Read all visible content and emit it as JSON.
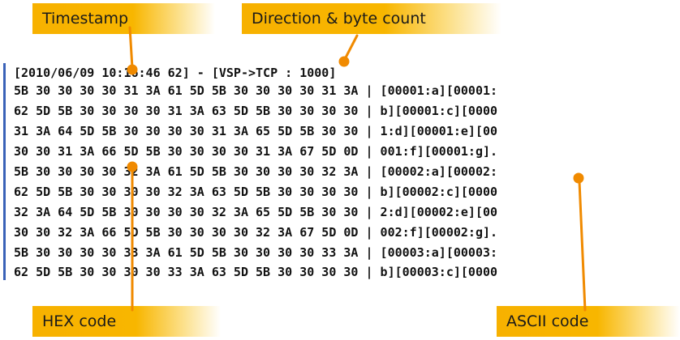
{
  "callouts": {
    "timestamp": "Timestamp",
    "direction": "Direction & byte count",
    "hex": "HEX code",
    "ascii": "ASCII code"
  },
  "log": {
    "header": "[2010/06/09 10:16:46 62] - [VSP->TCP : 1000]",
    "rows": [
      {
        "hex": "5B 30 30 30 30 31 3A 61 5D 5B 30 30 30 30 31 3A",
        "ascii": "[00001:a][00001:"
      },
      {
        "hex": "62 5D 5B 30 30 30 30 31 3A 63 5D 5B 30 30 30 30",
        "ascii": "b][00001:c][0000"
      },
      {
        "hex": "31 3A 64 5D 5B 30 30 30 30 31 3A 65 5D 5B 30 30",
        "ascii": "1:d][00001:e][00"
      },
      {
        "hex": "30 30 31 3A 66 5D 5B 30 30 30 30 31 3A 67 5D 0D",
        "ascii": "001:f][00001:g]."
      },
      {
        "hex": "5B 30 30 30 30 32 3A 61 5D 5B 30 30 30 30 32 3A",
        "ascii": "[00002:a][00002:"
      },
      {
        "hex": "62 5D 5B 30 30 30 30 32 3A 63 5D 5B 30 30 30 30",
        "ascii": "b][00002:c][0000"
      },
      {
        "hex": "32 3A 64 5D 5B 30 30 30 30 32 3A 65 5D 5B 30 30",
        "ascii": "2:d][00002:e][00"
      },
      {
        "hex": "30 30 32 3A 66 5D 5B 30 30 30 30 32 3A 67 5D 0D",
        "ascii": "002:f][00002:g]."
      },
      {
        "hex": "5B 30 30 30 30 33 3A 61 5D 5B 30 30 30 30 33 3A",
        "ascii": "[00003:a][00003:"
      },
      {
        "hex": "62 5D 5B 30 30 30 30 33 3A 63 5D 5B 30 30 30 30",
        "ascii": "b][00003:c][0000"
      }
    ],
    "separator": " | "
  },
  "colors": {
    "callout": "#f7b100",
    "leader": "#f08a00",
    "border": "#3a62b8"
  }
}
